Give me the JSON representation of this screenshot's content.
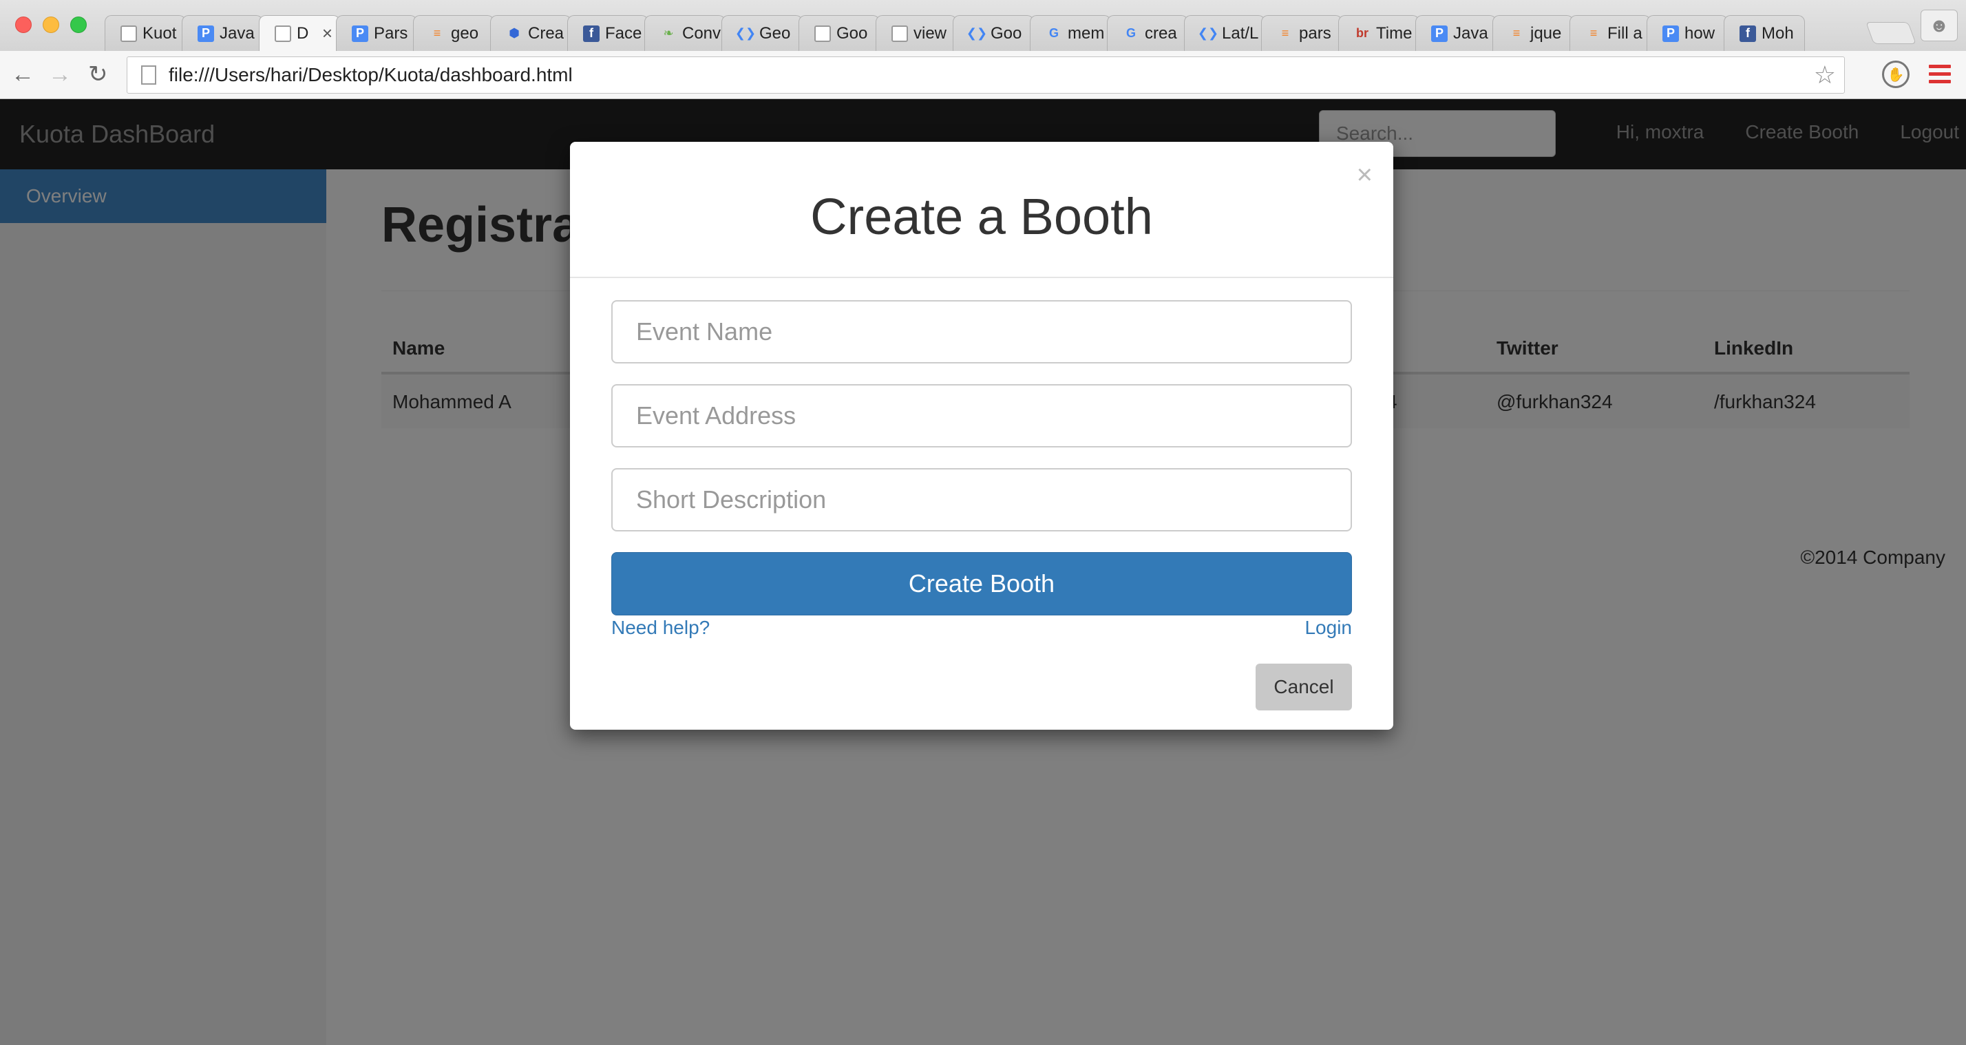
{
  "browser": {
    "tabs": [
      {
        "title": "Kuot",
        "icon": "page-icon",
        "active": false
      },
      {
        "title": "Java",
        "icon": "p-icon",
        "active": false
      },
      {
        "title": "D",
        "icon": "page-icon",
        "active": true
      },
      {
        "title": "Pars",
        "icon": "p-icon",
        "active": false
      },
      {
        "title": "geo",
        "icon": "stackoverflow-icon",
        "active": false
      },
      {
        "title": "Crea",
        "icon": "hexagon-icon",
        "active": false
      },
      {
        "title": "Face",
        "icon": "facebook-icon",
        "active": false
      },
      {
        "title": "Conv",
        "icon": "leaf-icon",
        "active": false
      },
      {
        "title": "Geo",
        "icon": "google-dev-icon",
        "active": false
      },
      {
        "title": "Goo",
        "icon": "page-icon",
        "active": false
      },
      {
        "title": "view",
        "icon": "page-icon",
        "active": false
      },
      {
        "title": "Goo",
        "icon": "google-dev-icon",
        "active": false
      },
      {
        "title": "mem",
        "icon": "google-icon",
        "active": false
      },
      {
        "title": "crea",
        "icon": "google-icon",
        "active": false
      },
      {
        "title": "Lat/L",
        "icon": "google-dev-icon",
        "active": false
      },
      {
        "title": "pars",
        "icon": "stackoverflow-icon",
        "active": false
      },
      {
        "title": "Time",
        "icon": "br-icon",
        "active": false
      },
      {
        "title": "Java",
        "icon": "p-icon",
        "active": false
      },
      {
        "title": "jque",
        "icon": "stackoverflow-icon",
        "active": false
      },
      {
        "title": "Fill a",
        "icon": "stackoverflow-icon",
        "active": false
      },
      {
        "title": "how",
        "icon": "p-icon",
        "active": false
      },
      {
        "title": "Moh",
        "icon": "facebook-icon",
        "active": false
      }
    ],
    "url": "file:///Users/hari/Desktop/Kuota/dashboard.html"
  },
  "navbar": {
    "brand": "Kuota DashBoard",
    "search_placeholder": "Search...",
    "links": [
      "Hi, moxtra",
      "Create Booth",
      "Logout"
    ]
  },
  "sidebar": {
    "active_item": "Overview"
  },
  "main": {
    "title_visible": "Registra",
    "table": {
      "headers": [
        "Name",
        "Twitter",
        "LinkedIn"
      ],
      "row": {
        "name": "Mohammed A",
        "partial": "4",
        "twitter": "@furkhan324",
        "linkedin": "/furkhan324"
      }
    },
    "footer": "©2014 Company"
  },
  "modal": {
    "close_glyph": "×",
    "title": "Create a Booth",
    "fields": {
      "event_name": "Event Name",
      "event_address": "Event Address",
      "short_description": "Short Description"
    },
    "submit_label": "Create Booth",
    "help_link": "Need help?",
    "login_link": "Login",
    "cancel_label": "Cancel"
  },
  "colors": {
    "primary": "#337ab7",
    "navbar_bg": "#222222",
    "sidebar_active": "#428bca"
  }
}
